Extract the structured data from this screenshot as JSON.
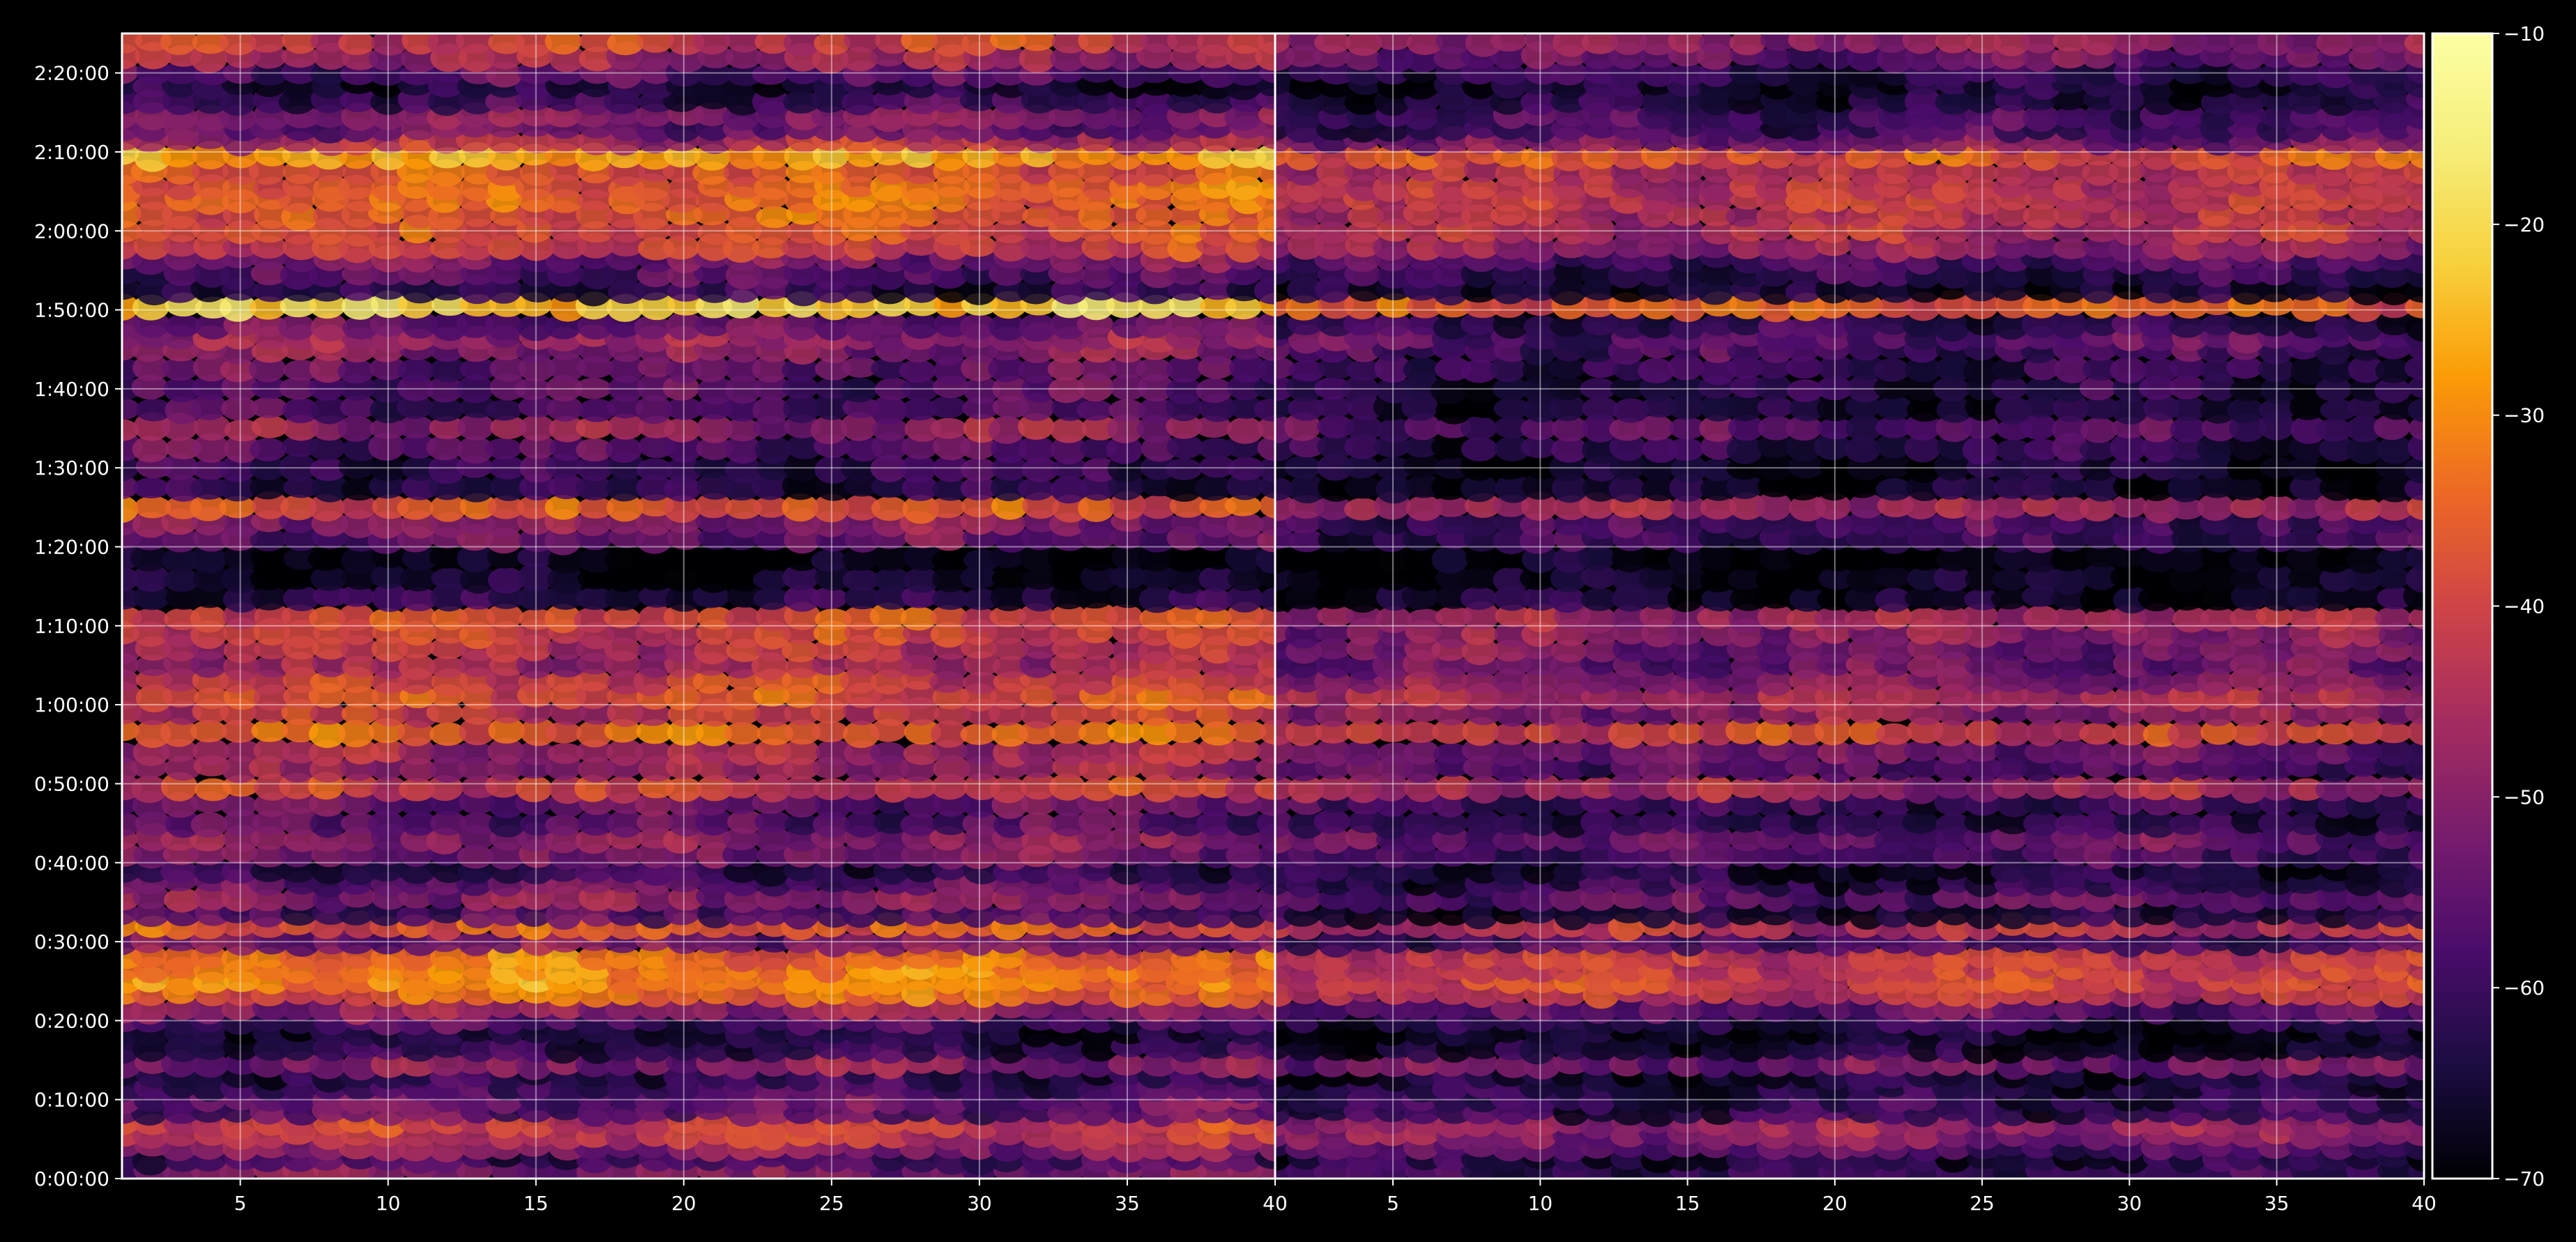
{
  "chart_data": {
    "type": "heatmap",
    "colormap": "inferno",
    "background": "#000000",
    "grid": true,
    "panels": [
      {
        "name": "",
        "xlim": [
          1,
          40
        ],
        "xticks": [
          "5",
          "10",
          "15",
          "20",
          "25",
          "30",
          "35"
        ],
        "ylim": [
          "0:00:00",
          "2:25:00"
        ],
        "yticks": [
          "0:00:00",
          "0:10:00",
          "0:20:00",
          "0:30:00",
          "0:40:00",
          "0:50:00",
          "1:00:00",
          "1:10:00",
          "1:20:00",
          "1:30:00",
          "1:40:00",
          "1:50:00",
          "2:00:00",
          "2:10:00",
          "2:20:00"
        ],
        "bands": [
          {
            "t": "0:01:00",
            "level": -52
          },
          {
            "t": "0:02:30",
            "level": -60
          },
          {
            "t": "0:04:00",
            "level": -50
          },
          {
            "t": "0:05:30",
            "level": -42
          },
          {
            "t": "0:07:00",
            "level": -40
          },
          {
            "t": "0:08:30",
            "level": -56
          },
          {
            "t": "0:10:00",
            "level": -54
          },
          {
            "t": "0:11:30",
            "level": -60
          },
          {
            "t": "0:13:00",
            "level": -62
          },
          {
            "t": "0:14:30",
            "level": -50
          },
          {
            "t": "0:16:30",
            "level": -62
          },
          {
            "t": "0:18:30",
            "level": -64
          },
          {
            "t": "0:20:00",
            "level": -58
          },
          {
            "t": "0:21:30",
            "level": -48
          },
          {
            "t": "0:23:30",
            "level": -34
          },
          {
            "t": "0:25:00",
            "level": -30
          },
          {
            "t": "0:26:30",
            "level": -32
          },
          {
            "t": "0:28:00",
            "level": -33
          },
          {
            "t": "0:30:00",
            "level": -52
          },
          {
            "t": "0:32:00",
            "level": -36
          },
          {
            "t": "0:33:30",
            "level": -58
          },
          {
            "t": "0:35:30",
            "level": -50
          },
          {
            "t": "0:37:30",
            "level": -55
          },
          {
            "t": "0:39:00",
            "level": -62
          },
          {
            "t": "0:41:00",
            "level": -52
          },
          {
            "t": "0:43:00",
            "level": -48
          },
          {
            "t": "0:45:00",
            "level": -56
          },
          {
            "t": "0:47:30",
            "level": -54
          },
          {
            "t": "0:49:30",
            "level": -40
          },
          {
            "t": "0:52:00",
            "level": -48
          },
          {
            "t": "0:54:00",
            "level": -46
          },
          {
            "t": "0:56:30",
            "level": -34
          },
          {
            "t": "0:59:00",
            "level": -42
          },
          {
            "t": "1:01:00",
            "level": -38
          },
          {
            "t": "1:03:00",
            "level": -40
          },
          {
            "t": "1:05:00",
            "level": -46
          },
          {
            "t": "1:07:00",
            "level": -44
          },
          {
            "t": "1:09:00",
            "level": -40
          },
          {
            "t": "1:11:00",
            "level": -38
          },
          {
            "t": "1:13:30",
            "level": -62
          },
          {
            "t": "1:16:00",
            "level": -66
          },
          {
            "t": "1:18:30",
            "level": -68
          },
          {
            "t": "1:21:00",
            "level": -54
          },
          {
            "t": "1:23:00",
            "level": -50
          },
          {
            "t": "1:25:00",
            "level": -36
          },
          {
            "t": "1:27:30",
            "level": -62
          },
          {
            "t": "1:30:00",
            "level": -60
          },
          {
            "t": "1:32:30",
            "level": -56
          },
          {
            "t": "1:35:00",
            "level": -48
          },
          {
            "t": "1:37:30",
            "level": -58
          },
          {
            "t": "1:40:00",
            "level": -56
          },
          {
            "t": "1:42:30",
            "level": -54
          },
          {
            "t": "1:45:00",
            "level": -50
          },
          {
            "t": "1:46:30",
            "level": -48
          },
          {
            "t": "1:48:00",
            "level": -54
          },
          {
            "t": "1:50:30",
            "level": -22
          },
          {
            "t": "1:52:30",
            "level": -62
          },
          {
            "t": "1:54:30",
            "level": -56
          },
          {
            "t": "1:56:30",
            "level": -52
          },
          {
            "t": "1:58:00",
            "level": -40
          },
          {
            "t": "2:00:00",
            "level": -38
          },
          {
            "t": "2:02:00",
            "level": -36
          },
          {
            "t": "2:04:00",
            "level": -34
          },
          {
            "t": "2:05:30",
            "level": -34
          },
          {
            "t": "2:07:30",
            "level": -36
          },
          {
            "t": "2:09:30",
            "level": -26
          },
          {
            "t": "2:11:30",
            "level": -44
          },
          {
            "t": "2:13:00",
            "level": -54
          },
          {
            "t": "2:14:30",
            "level": -50
          },
          {
            "t": "2:16:30",
            "level": -60
          },
          {
            "t": "2:18:30",
            "level": -64
          },
          {
            "t": "2:20:00",
            "level": -56
          },
          {
            "t": "2:22:00",
            "level": -46
          },
          {
            "t": "2:24:00",
            "level": -40
          }
        ]
      },
      {
        "name": "",
        "xlim": [
          1,
          40
        ],
        "xticks": [
          "5",
          "10",
          "15",
          "20",
          "25",
          "30",
          "35",
          "40"
        ],
        "ylim": [
          "0:00:00",
          "2:25:00"
        ],
        "bands": [
          {
            "t": "0:01:00",
            "level": -60
          },
          {
            "t": "0:02:30",
            "level": -64
          },
          {
            "t": "0:04:00",
            "level": -56
          },
          {
            "t": "0:05:30",
            "level": -50
          },
          {
            "t": "0:07:00",
            "level": -48
          },
          {
            "t": "0:08:30",
            "level": -62
          },
          {
            "t": "0:10:00",
            "level": -62
          },
          {
            "t": "0:11:30",
            "level": -64
          },
          {
            "t": "0:13:00",
            "level": -66
          },
          {
            "t": "0:14:30",
            "level": -52
          },
          {
            "t": "0:16:30",
            "level": -66
          },
          {
            "t": "0:18:30",
            "level": -68
          },
          {
            "t": "0:20:00",
            "level": -62
          },
          {
            "t": "0:21:30",
            "level": -56
          },
          {
            "t": "0:23:30",
            "level": -42
          },
          {
            "t": "0:25:00",
            "level": -40
          },
          {
            "t": "0:26:30",
            "level": -42
          },
          {
            "t": "0:28:00",
            "level": -42
          },
          {
            "t": "0:30:00",
            "level": -58
          },
          {
            "t": "0:32:00",
            "level": -44
          },
          {
            "t": "0:33:30",
            "level": -64
          },
          {
            "t": "0:35:30",
            "level": -56
          },
          {
            "t": "0:37:30",
            "level": -62
          },
          {
            "t": "0:39:00",
            "level": -66
          },
          {
            "t": "0:41:00",
            "level": -58
          },
          {
            "t": "0:43:00",
            "level": -54
          },
          {
            "t": "0:45:00",
            "level": -62
          },
          {
            "t": "0:47:30",
            "level": -60
          },
          {
            "t": "0:49:30",
            "level": -46
          },
          {
            "t": "0:52:00",
            "level": -56
          },
          {
            "t": "0:54:00",
            "level": -54
          },
          {
            "t": "0:56:30",
            "level": -40
          },
          {
            "t": "0:59:00",
            "level": -50
          },
          {
            "t": "1:01:00",
            "level": -46
          },
          {
            "t": "1:03:00",
            "level": -50
          },
          {
            "t": "1:05:00",
            "level": -54
          },
          {
            "t": "1:07:00",
            "level": -52
          },
          {
            "t": "1:09:00",
            "level": -50
          },
          {
            "t": "1:11:00",
            "level": -46
          },
          {
            "t": "1:13:30",
            "level": -66
          },
          {
            "t": "1:16:00",
            "level": -68
          },
          {
            "t": "1:18:30",
            "level": -69
          },
          {
            "t": "1:21:00",
            "level": -60
          },
          {
            "t": "1:23:00",
            "level": -58
          },
          {
            "t": "1:25:00",
            "level": -46
          },
          {
            "t": "1:27:30",
            "level": -66
          },
          {
            "t": "1:30:00",
            "level": -66
          },
          {
            "t": "1:32:30",
            "level": -62
          },
          {
            "t": "1:35:00",
            "level": -56
          },
          {
            "t": "1:37:30",
            "level": -64
          },
          {
            "t": "1:40:00",
            "level": -62
          },
          {
            "t": "1:42:30",
            "level": -60
          },
          {
            "t": "1:45:00",
            "level": -58
          },
          {
            "t": "1:46:30",
            "level": -56
          },
          {
            "t": "1:48:00",
            "level": -62
          },
          {
            "t": "1:50:30",
            "level": -36
          },
          {
            "t": "1:52:30",
            "level": -66
          },
          {
            "t": "1:54:30",
            "level": -62
          },
          {
            "t": "1:56:30",
            "level": -58
          },
          {
            "t": "1:58:00",
            "level": -48
          },
          {
            "t": "2:00:00",
            "level": -44
          },
          {
            "t": "2:02:00",
            "level": -44
          },
          {
            "t": "2:04:00",
            "level": -42
          },
          {
            "t": "2:05:30",
            "level": -42
          },
          {
            "t": "2:07:30",
            "level": -44
          },
          {
            "t": "2:09:30",
            "level": -36
          },
          {
            "t": "2:11:30",
            "level": -52
          },
          {
            "t": "2:13:00",
            "level": -60
          },
          {
            "t": "2:14:30",
            "level": -58
          },
          {
            "t": "2:16:30",
            "level": -64
          },
          {
            "t": "2:18:30",
            "level": -66
          },
          {
            "t": "2:20:00",
            "level": -62
          },
          {
            "t": "2:22:00",
            "level": -54
          },
          {
            "t": "2:24:00",
            "level": -48
          }
        ]
      }
    ],
    "colorbar": {
      "range": [
        -70,
        -10
      ],
      "ticks": [
        "−10",
        "−20",
        "−30",
        "−40",
        "−50",
        "−60",
        "−70"
      ]
    }
  }
}
